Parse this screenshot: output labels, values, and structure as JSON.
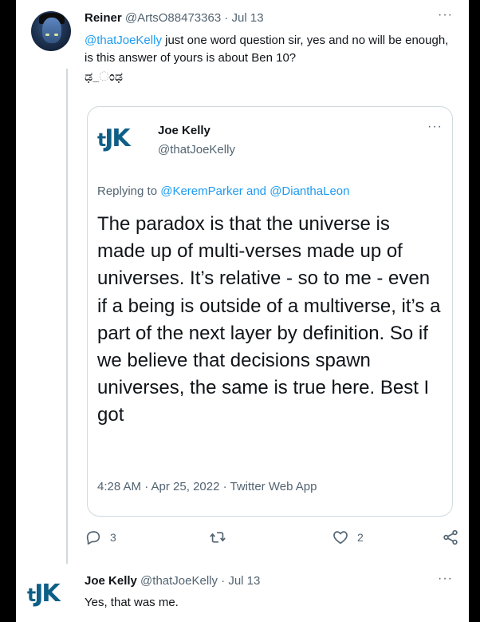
{
  "top_tweet": {
    "name": "Reiner",
    "handle": "@ArtsO88473363",
    "separator": "·",
    "date": "Jul 13",
    "more": "···",
    "mention": "@thatJoeKelly",
    "text": " just one word question sir, yes and no will be enough, is this answer of yours is about Ben 10?",
    "extra_line": "ಢ_ಂಢ"
  },
  "quoted_tweet": {
    "logo": {
      "t": "t",
      "jk": "JK"
    },
    "name": "Joe Kelly",
    "handle": "@thatJoeKelly",
    "more": "···",
    "replying_prefix": "Replying to ",
    "replying_user1": "@KeremParker",
    "replying_and": " and ",
    "replying_user2": "@DianthaLeon",
    "body": "The paradox is that the universe is made up of multi-verses made up of universes. It’s relative - so to me - even if a being is outside of a multiverse, it’s a part of the next layer by definition. So if we believe that decisions spawn universes, the same is true here. Best I got",
    "meta": "4:28 AM · Apr 25, 2022 · Twitter Web App"
  },
  "actions": {
    "reply_count": "3",
    "retweet_count": "",
    "like_count": "2",
    "icons": [
      "reply-icon",
      "retweet-icon",
      "like-icon",
      "share-icon"
    ]
  },
  "bottom_tweet": {
    "logo": {
      "t": "t",
      "jk": "JK"
    },
    "name": "Joe Kelly",
    "handle": "@thatJoeKelly",
    "separator": "·",
    "date": "Jul 13",
    "more": "···",
    "text": "Yes, that was me."
  },
  "colors": {
    "link": "#1d9bf0",
    "muted": "#536471",
    "text": "#0f1419",
    "logo": "#0e5f86",
    "border": "#cfd9de"
  }
}
